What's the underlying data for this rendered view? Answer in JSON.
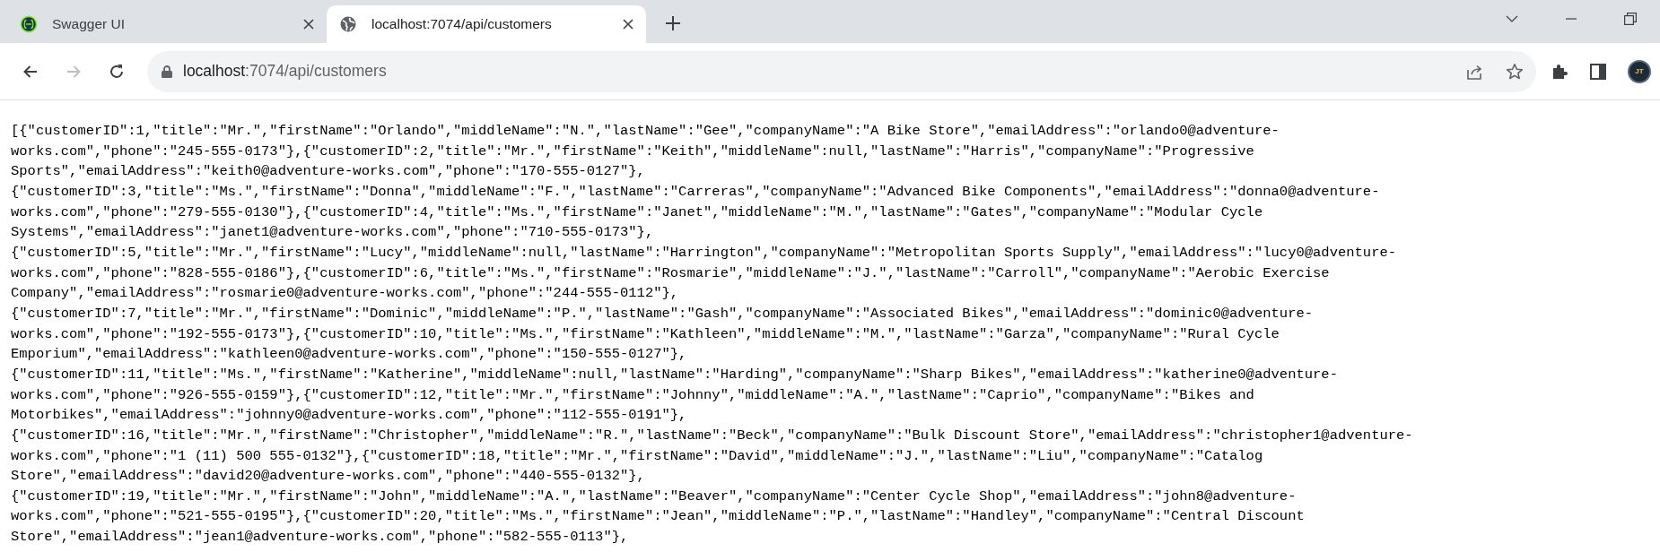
{
  "tabs": [
    {
      "title": "Swagger UI",
      "kind": "swagger",
      "selected": false
    },
    {
      "title": "localhost:7074/api/customers",
      "kind": "globe",
      "selected": true
    }
  ],
  "nav_buttons": [
    {
      "kind": "back",
      "disabled": false
    },
    {
      "kind": "forward",
      "disabled": true
    },
    {
      "kind": "reload",
      "disabled": false
    }
  ],
  "address_bar": {
    "host": "localhost",
    "path": ":7074/api/customers"
  },
  "profile": {
    "initials": "JT"
  },
  "body_lines": [
    "[{\"customerID\":1,\"title\":\"Mr.\",\"firstName\":\"Orlando\",\"middleName\":\"N.\",\"lastName\":\"Gee\",\"companyName\":\"A Bike Store\",\"emailAddress\":\"orlando0@adventure-",
    "works.com\",\"phone\":\"245-555-0173\"},{\"customerID\":2,\"title\":\"Mr.\",\"firstName\":\"Keith\",\"middleName\":null,\"lastName\":\"Harris\",\"companyName\":\"Progressive",
    "Sports\",\"emailAddress\":\"keith0@adventure-works.com\",\"phone\":\"170-555-0127\"},",
    "{\"customerID\":3,\"title\":\"Ms.\",\"firstName\":\"Donna\",\"middleName\":\"F.\",\"lastName\":\"Carreras\",\"companyName\":\"Advanced Bike Components\",\"emailAddress\":\"donna0@adventure-",
    "works.com\",\"phone\":\"279-555-0130\"},{\"customerID\":4,\"title\":\"Ms.\",\"firstName\":\"Janet\",\"middleName\":\"M.\",\"lastName\":\"Gates\",\"companyName\":\"Modular Cycle",
    "Systems\",\"emailAddress\":\"janet1@adventure-works.com\",\"phone\":\"710-555-0173\"},",
    "{\"customerID\":5,\"title\":\"Mr.\",\"firstName\":\"Lucy\",\"middleName\":null,\"lastName\":\"Harrington\",\"companyName\":\"Metropolitan Sports Supply\",\"emailAddress\":\"lucy0@adventure-",
    "works.com\",\"phone\":\"828-555-0186\"},{\"customerID\":6,\"title\":\"Ms.\",\"firstName\":\"Rosmarie\",\"middleName\":\"J.\",\"lastName\":\"Carroll\",\"companyName\":\"Aerobic Exercise",
    "Company\",\"emailAddress\":\"rosmarie0@adventure-works.com\",\"phone\":\"244-555-0112\"},",
    "{\"customerID\":7,\"title\":\"Mr.\",\"firstName\":\"Dominic\",\"middleName\":\"P.\",\"lastName\":\"Gash\",\"companyName\":\"Associated Bikes\",\"emailAddress\":\"dominic0@adventure-",
    "works.com\",\"phone\":\"192-555-0173\"},{\"customerID\":10,\"title\":\"Ms.\",\"firstName\":\"Kathleen\",\"middleName\":\"M.\",\"lastName\":\"Garza\",\"companyName\":\"Rural Cycle",
    "Emporium\",\"emailAddress\":\"kathleen0@adventure-works.com\",\"phone\":\"150-555-0127\"},",
    "{\"customerID\":11,\"title\":\"Ms.\",\"firstName\":\"Katherine\",\"middleName\":null,\"lastName\":\"Harding\",\"companyName\":\"Sharp Bikes\",\"emailAddress\":\"katherine0@adventure-",
    "works.com\",\"phone\":\"926-555-0159\"},{\"customerID\":12,\"title\":\"Mr.\",\"firstName\":\"Johnny\",\"middleName\":\"A.\",\"lastName\":\"Caprio\",\"companyName\":\"Bikes and",
    "Motorbikes\",\"emailAddress\":\"johnny0@adventure-works.com\",\"phone\":\"112-555-0191\"},",
    "{\"customerID\":16,\"title\":\"Mr.\",\"firstName\":\"Christopher\",\"middleName\":\"R.\",\"lastName\":\"Beck\",\"companyName\":\"Bulk Discount Store\",\"emailAddress\":\"christopher1@adventure-",
    "works.com\",\"phone\":\"1 (11) 500 555-0132\"},{\"customerID\":18,\"title\":\"Mr.\",\"firstName\":\"David\",\"middleName\":\"J.\",\"lastName\":\"Liu\",\"companyName\":\"Catalog",
    "Store\",\"emailAddress\":\"david20@adventure-works.com\",\"phone\":\"440-555-0132\"},",
    "{\"customerID\":19,\"title\":\"Mr.\",\"firstName\":\"John\",\"middleName\":\"A.\",\"lastName\":\"Beaver\",\"companyName\":\"Center Cycle Shop\",\"emailAddress\":\"john8@adventure-",
    "works.com\",\"phone\":\"521-555-0195\"},{\"customerID\":20,\"title\":\"Ms.\",\"firstName\":\"Jean\",\"middleName\":\"P.\",\"lastName\":\"Handley\",\"companyName\":\"Central Discount",
    "Store\",\"emailAddress\":\"jean1@adventure-works.com\",\"phone\":\"582-555-0113\"},"
  ]
}
